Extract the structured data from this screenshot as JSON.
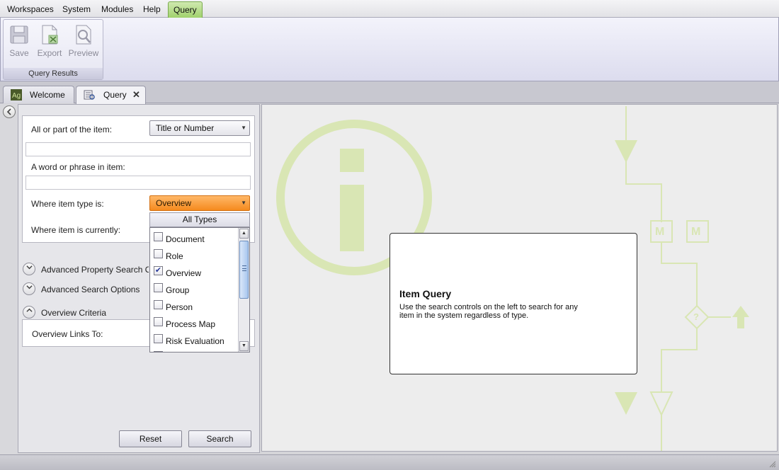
{
  "menu": {
    "items": [
      "Workspaces",
      "System",
      "Modules",
      "Help"
    ],
    "active": "Query"
  },
  "ribbon": {
    "buttons": [
      {
        "label": "Save",
        "icon": "save-icon"
      },
      {
        "label": "Export",
        "icon": "excel-export-icon"
      },
      {
        "label": "Preview",
        "icon": "preview-icon"
      }
    ],
    "group_label": "Query Results"
  },
  "tabs": [
    {
      "label": "Welcome",
      "icon": "app-logo-icon"
    },
    {
      "label": "Query",
      "icon": "query-icon",
      "close_icon": "close-icon",
      "close_glyph": "✕"
    }
  ],
  "form": {
    "item_label": "All or part of the item:",
    "item_mode": "Title or Number",
    "item_value": "",
    "phrase_label": "A word or phrase in item:",
    "phrase_value": "",
    "type_label": "Where item type is:",
    "type_selected": "Overview",
    "status_label": "Where item is currently:"
  },
  "sections": {
    "advanced_property": "Advanced Property Search Options",
    "advanced_search": "Advanced Search Options",
    "overview_criteria": "Overview Criteria",
    "overview_links_label": "Overview Links To:"
  },
  "buttons": {
    "reset": "Reset",
    "search": "Search"
  },
  "dropdown": {
    "header": "All Types",
    "items": [
      {
        "label": "Document",
        "checked": false
      },
      {
        "label": "Role",
        "checked": false
      },
      {
        "label": "Overview",
        "checked": true
      },
      {
        "label": "Group",
        "checked": false
      },
      {
        "label": "Person",
        "checked": false
      },
      {
        "label": "Process Map",
        "checked": false
      },
      {
        "label": "Risk Evaluation",
        "checked": false
      }
    ],
    "check_glyph": "✔"
  },
  "info": {
    "title": "Item Query",
    "text": "Use the search controls on the left to search for any item in the system regardless of type."
  },
  "watermark": {
    "map_box_text": "M",
    "decision_text": "?"
  },
  "colors": {
    "accent_orange": "#f58a1e",
    "active_tab_green": "#9ed069",
    "watermark_green": "#d9e6b4"
  }
}
